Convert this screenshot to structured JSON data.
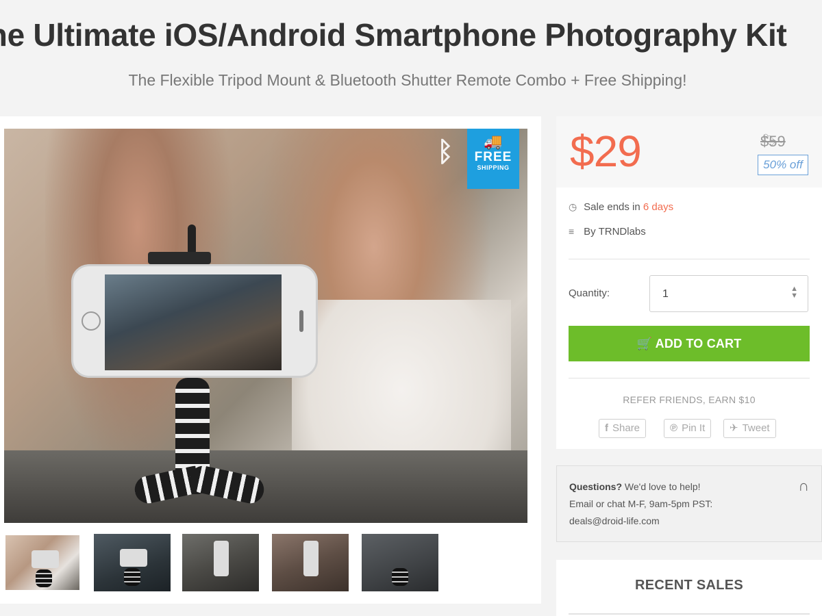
{
  "header": {
    "title": "The Ultimate iOS/Android Smartphone Photography Kit",
    "subtitle": "The Flexible Tripod Mount & Bluetooth Shutter Remote Combo + Free Shipping!"
  },
  "gallery": {
    "badge_free": "FREE",
    "badge_shipping": "SHIPPING",
    "bluetooth_icon": "bluetooth-icon",
    "truck_icon": "truck-icon",
    "thumbnail_count": 5,
    "selected_thumbnail": 1
  },
  "pricing": {
    "price": "$29",
    "original_price": "$59",
    "discount": "50% off",
    "accent_color": "#f26c4f"
  },
  "details": {
    "sale_ends_prefix": "Sale ends in",
    "sale_ends_value": "6 days",
    "vendor": "By TRNDlabs"
  },
  "purchase": {
    "quantity_label": "Quantity:",
    "quantity_value": "1",
    "add_to_cart": "ADD TO CART",
    "button_color": "#6dbd2a"
  },
  "share": {
    "refer_text": "REFER FRIENDS, EARN $10",
    "facebook": "Share",
    "pinterest": "Pin It",
    "twitter": "Tweet"
  },
  "help": {
    "questions": "Questions?",
    "help_text": "We'd love to help!",
    "hours": "Email or chat M-F, 9am-5pm PST:",
    "email": "deals@droid-life.com"
  },
  "recent_sales": {
    "heading": "RECENT SALES"
  }
}
